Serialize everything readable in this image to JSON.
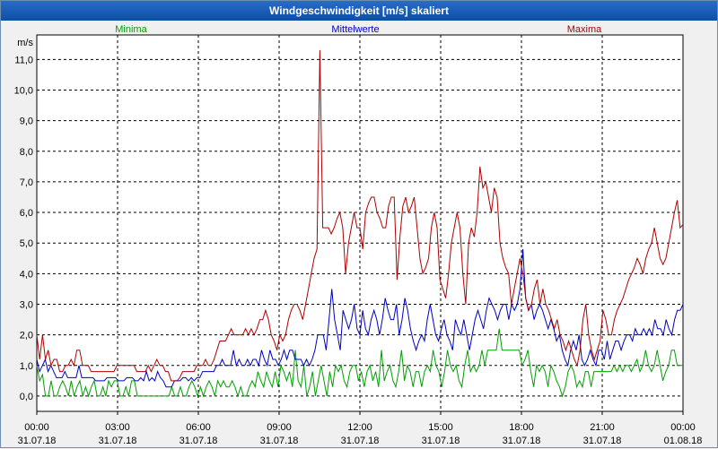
{
  "window": {
    "title": "Windgeschwindigkeit [m/s] skaliert"
  },
  "chart_data": {
    "type": "line",
    "unit_label": "m/s",
    "ylim": [
      -0.5,
      11.8
    ],
    "y_ticks": [
      "0,0",
      "1,0",
      "2,0",
      "3,0",
      "4,0",
      "5,0",
      "6,0",
      "7,0",
      "8,0",
      "9,0",
      "10,0",
      "11,0"
    ],
    "x_ticks": [
      {
        "time": "00:00",
        "date": "31.07.18"
      },
      {
        "time": "03:00",
        "date": "31.07.18"
      },
      {
        "time": "06:00",
        "date": "31.07.18"
      },
      {
        "time": "09:00",
        "date": "31.07.18"
      },
      {
        "time": "12:00",
        "date": "31.07.18"
      },
      {
        "time": "15:00",
        "date": "31.07.18"
      },
      {
        "time": "18:00",
        "date": "31.07.18"
      },
      {
        "time": "21:00",
        "date": "31.07.18"
      },
      {
        "time": "00:00",
        "date": "01.08.18"
      }
    ],
    "grid": true,
    "series": [
      {
        "name": "Minima",
        "color": "#00a000",
        "values": [
          1.0,
          0.5,
          0.7,
          0.0,
          0.0,
          0.5,
          0.0,
          0.0,
          0.3,
          0.5,
          0.3,
          0.0,
          0.5,
          0.0,
          0.3,
          0.5,
          0.0,
          0.3,
          0.0,
          0.3,
          0.5,
          0.0,
          0.0,
          0.3,
          0.0,
          0.5,
          0.3,
          0.5,
          0.5,
          0.0,
          0.0,
          0.3,
          0.0,
          0.5,
          0.5,
          0.0,
          0.0,
          0.0,
          0.0,
          0.0,
          0.0,
          0.0,
          0.0,
          0.0,
          0.0,
          0.0,
          0.0,
          0.3,
          0.0,
          0.0,
          0.3,
          0.0,
          0.0,
          0.3,
          0.5,
          0.3,
          0.0,
          0.3,
          0.0,
          0.3,
          0.5,
          0.3,
          0.0,
          0.5,
          0.3,
          0.5,
          0.3,
          0.3,
          0.5,
          0.3,
          0.0,
          0.3,
          0.0,
          0.0,
          0.3,
          0.5,
          0.3,
          0.8,
          0.5,
          0.3,
          0.8,
          0.5,
          0.3,
          0.8,
          0.3,
          1.0,
          0.8,
          0.5,
          0.8,
          0.3,
          1.5,
          0.5,
          0.3,
          1.0,
          0.0,
          0.3,
          0.8,
          0.0,
          0.5,
          1.0,
          0.5,
          0.0,
          0.8,
          0.3,
          1.0,
          0.8,
          1.0,
          0.5,
          0.3,
          0.8,
          1.0,
          1.0,
          0.5,
          0.8,
          0.3,
          0.8,
          1.0,
          0.5,
          0.8,
          0.3,
          1.5,
          0.5,
          0.8,
          1.0,
          0.5,
          0.3,
          0.8,
          1.5,
          0.5,
          1.0,
          0.8,
          0.3,
          0.8,
          0.8,
          0.3,
          0.8,
          1.0,
          0.8,
          1.5,
          1.0,
          0.8,
          0.3,
          0.8,
          1.5,
          1.0,
          0.8,
          1.0,
          0.5,
          0.3,
          1.0,
          1.5,
          0.8,
          1.0,
          0.8,
          1.0,
          1.5,
          1.0,
          1.5,
          1.5,
          1.5,
          1.5,
          2.2,
          1.5,
          1.5,
          1.5,
          1.5,
          1.5,
          1.5,
          1.5,
          1.0,
          1.2,
          1.5,
          0.8,
          0.3,
          1.0,
          0.8,
          1.0,
          0.8,
          0.3,
          1.0,
          0.8,
          0.5,
          0.3,
          0.0,
          0.3,
          0.8,
          1.0,
          0.8,
          0.3,
          0.5,
          0.3,
          0.8,
          0.8,
          0.3,
          0.8,
          0.8,
          0.8,
          0.8,
          0.8,
          0.8,
          0.8,
          1.0,
          0.8,
          1.0,
          0.8,
          1.0,
          1.0,
          0.8,
          1.0,
          1.2,
          0.8,
          1.0,
          1.5,
          1.0,
          0.8,
          1.0,
          1.5,
          1.0,
          0.5,
          0.8,
          1.0,
          1.5,
          1.5,
          1.0,
          1.0,
          1.0
        ]
      },
      {
        "name": "Mittelwerte",
        "color": "#0000c0",
        "values": [
          1.2,
          0.8,
          1.0,
          1.2,
          0.8,
          1.0,
          0.8,
          0.6,
          0.6,
          0.6,
          0.8,
          0.6,
          0.6,
          0.6,
          0.6,
          1.0,
          0.6,
          0.6,
          0.6,
          0.6,
          0.6,
          0.5,
          0.5,
          0.5,
          0.5,
          0.6,
          0.6,
          0.6,
          0.6,
          0.5,
          0.5,
          0.5,
          0.6,
          0.6,
          0.6,
          0.5,
          0.5,
          0.6,
          0.5,
          0.8,
          0.5,
          0.6,
          0.5,
          0.8,
          0.6,
          0.5,
          0.3,
          0.3,
          0.3,
          0.5,
          0.5,
          0.5,
          0.6,
          0.6,
          0.5,
          0.6,
          0.5,
          0.6,
          0.6,
          0.8,
          0.8,
          0.8,
          0.8,
          0.8,
          1.0,
          1.0,
          1.2,
          1.0,
          1.0,
          1.0,
          1.5,
          1.0,
          1.2,
          1.0,
          1.0,
          1.2,
          1.0,
          1.2,
          1.2,
          1.0,
          1.5,
          1.2,
          1.0,
          1.5,
          1.2,
          1.2,
          1.0,
          1.2,
          1.5,
          1.2,
          1.5,
          1.5,
          1.2,
          1.2,
          1.2,
          1.0,
          1.2,
          1.0,
          1.2,
          1.5,
          2.0,
          2.0,
          2.0,
          1.5,
          2.5,
          3.5,
          2.5,
          2.0,
          1.5,
          2.8,
          2.5,
          2.2,
          2.5,
          3.0,
          2.2,
          2.0,
          2.8,
          2.2,
          2.0,
          2.5,
          2.8,
          2.5,
          2.0,
          2.5,
          3.2,
          2.8,
          2.5,
          2.5,
          3.0,
          2.0,
          2.5,
          3.2,
          2.8,
          2.2,
          1.8,
          1.5,
          1.8,
          2.0,
          1.8,
          2.5,
          3.0,
          2.5,
          2.0,
          1.8,
          2.2,
          2.5,
          2.0,
          1.8,
          1.5,
          2.5,
          2.2,
          2.0,
          2.5,
          2.0,
          1.5,
          2.0,
          2.5,
          2.8,
          2.5,
          2.2,
          2.8,
          3.2,
          3.0,
          2.8,
          2.5,
          2.8,
          3.0,
          3.0,
          2.5,
          3.0,
          2.8,
          3.0,
          3.5,
          4.8,
          3.2,
          2.8,
          3.0,
          2.5,
          2.8,
          3.0,
          2.8,
          2.5,
          2.2,
          2.5,
          2.2,
          1.8,
          2.0,
          1.5,
          1.2,
          1.0,
          1.5,
          1.8,
          1.5,
          2.0,
          1.2,
          1.0,
          1.2,
          1.5,
          1.2,
          1.0,
          1.5,
          1.5,
          1.2,
          1.8,
          1.2,
          1.5,
          1.8,
          1.8,
          1.5,
          1.8,
          2.0,
          2.0,
          1.8,
          2.2,
          2.0,
          2.0,
          2.2,
          2.0,
          2.2,
          2.0,
          2.5,
          2.2,
          2.2,
          2.0,
          2.5,
          2.2,
          2.0,
          2.5,
          2.8,
          2.8,
          3.0
        ]
      },
      {
        "name": "Maxima",
        "color": "#b00000",
        "values": [
          2.0,
          1.2,
          2.0,
          1.2,
          1.5,
          1.0,
          1.2,
          1.2,
          0.8,
          0.8,
          1.0,
          1.0,
          1.2,
          1.0,
          1.5,
          1.5,
          1.0,
          1.0,
          1.0,
          0.8,
          0.8,
          0.8,
          0.8,
          0.8,
          0.8,
          0.8,
          0.8,
          0.8,
          1.0,
          1.0,
          1.0,
          1.0,
          1.0,
          1.0,
          1.0,
          0.8,
          0.8,
          0.8,
          0.8,
          1.0,
          0.8,
          1.0,
          1.2,
          1.0,
          1.0,
          0.8,
          0.8,
          0.5,
          0.5,
          0.5,
          0.6,
          0.8,
          0.8,
          0.8,
          0.8,
          0.8,
          1.0,
          1.0,
          1.0,
          1.2,
          1.0,
          1.0,
          1.2,
          1.5,
          1.8,
          1.8,
          1.8,
          2.0,
          2.2,
          2.0,
          2.0,
          2.0,
          2.0,
          2.2,
          2.0,
          2.2,
          2.0,
          2.2,
          2.5,
          2.5,
          2.8,
          2.5,
          2.0,
          1.8,
          1.5,
          2.0,
          1.8,
          2.0,
          2.5,
          2.8,
          3.0,
          3.0,
          2.8,
          2.5,
          3.0,
          3.5,
          4.0,
          4.5,
          4.8,
          11.3,
          5.5,
          5.5,
          5.5,
          5.3,
          5.5,
          5.8,
          6.0,
          5.5,
          4.0,
          5.0,
          5.5,
          6.0,
          5.5,
          5.5,
          4.8,
          6.0,
          6.3,
          6.5,
          6.5,
          6.0,
          5.8,
          5.5,
          5.5,
          6.2,
          6.5,
          6.5,
          3.8,
          5.2,
          6.2,
          6.5,
          6.0,
          6.2,
          6.5,
          5.5,
          4.5,
          4.0,
          4.2,
          4.5,
          5.5,
          6.0,
          5.5,
          3.8,
          3.5,
          3.2,
          4.0,
          5.0,
          5.5,
          6.0,
          5.5,
          4.0,
          3.0,
          5.0,
          5.5,
          5.2,
          6.0,
          7.5,
          6.8,
          7.0,
          6.5,
          6.0,
          6.8,
          6.5,
          5.0,
          4.5,
          4.2,
          4.0,
          3.0,
          3.5,
          4.0,
          4.5,
          4.0,
          3.2,
          2.8,
          3.0,
          3.5,
          3.8,
          3.0,
          3.5,
          3.0,
          2.8,
          2.5,
          2.2,
          2.5,
          2.0,
          1.8,
          1.5,
          1.8,
          1.5,
          1.2,
          1.0,
          1.5,
          2.5,
          3.0,
          2.0,
          1.5,
          1.2,
          1.5,
          1.8,
          2.8,
          2.5,
          2.0,
          2.0,
          2.5,
          2.8,
          3.0,
          3.2,
          3.5,
          3.8,
          4.0,
          4.2,
          4.5,
          4.3,
          4.0,
          4.5,
          4.8,
          5.0,
          5.5,
          5.0,
          4.5,
          4.3,
          4.5,
          5.0,
          5.5,
          6.0,
          6.4,
          5.5,
          5.6
        ]
      }
    ]
  }
}
